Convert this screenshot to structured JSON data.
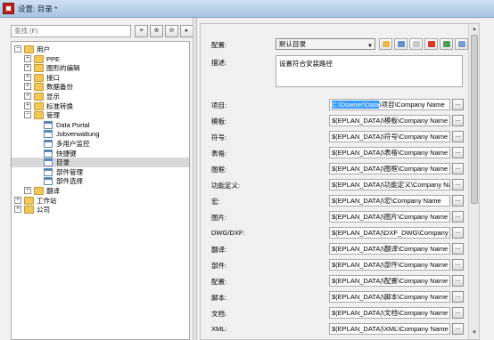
{
  "window": {
    "title": "设置: 目录 *"
  },
  "left": {
    "search_placeholder": "查找 (F)",
    "buttons": [
      "≡",
      "⊕",
      "⊖",
      "▸"
    ],
    "tree": [
      {
        "label": "用户",
        "level": 0,
        "type": "folder",
        "expander": "−"
      },
      {
        "label": "PPE",
        "level": 1,
        "type": "folder",
        "expander": "+"
      },
      {
        "label": "图形的编辑",
        "level": 1,
        "type": "folder",
        "expander": "+"
      },
      {
        "label": "接口",
        "level": 1,
        "type": "folder",
        "expander": "+"
      },
      {
        "label": "数据备份",
        "level": 1,
        "type": "folder",
        "expander": "+"
      },
      {
        "label": "显示",
        "level": 1,
        "type": "folder",
        "expander": "+"
      },
      {
        "label": "标准转换",
        "level": 1,
        "type": "folder",
        "expander": "+"
      },
      {
        "label": "管理",
        "level": 1,
        "type": "folder",
        "expander": "−"
      },
      {
        "label": "Data Portal",
        "level": 2,
        "type": "page",
        "expander": ""
      },
      {
        "label": "Jobverwaltung",
        "level": 2,
        "type": "page",
        "expander": ""
      },
      {
        "label": "多用户监控",
        "level": 2,
        "type": "page",
        "expander": ""
      },
      {
        "label": "快捷键",
        "level": 2,
        "type": "page",
        "expander": ""
      },
      {
        "label": "目录",
        "level": 2,
        "type": "page",
        "expander": "",
        "selected": true
      },
      {
        "label": "部件管理",
        "level": 2,
        "type": "page",
        "expander": ""
      },
      {
        "label": "部件选择",
        "level": 2,
        "type": "page",
        "expander": ""
      },
      {
        "label": "翻译",
        "level": 1,
        "type": "folder",
        "expander": "+"
      },
      {
        "label": "工作站",
        "level": 0,
        "type": "folder",
        "expander": "+"
      },
      {
        "label": "公司",
        "level": 0,
        "type": "folder",
        "expander": "+"
      }
    ]
  },
  "right": {
    "config_label": "配置:",
    "config_value": "默认目录",
    "desc_label": "描述:",
    "desc_value": "设置符合安装路径",
    "toolbar_colors": [
      "#e8b84a",
      "#6a8fc4",
      "#c8c8c8",
      "#d23a2c",
      "#4f9e58",
      "#7a9bc8"
    ],
    "browse_label": "...",
    "fields": [
      {
        "label": "项目:",
        "value": "C:\\Downer\\Data\\项目\\Company Name",
        "highlight": "C:\\Downer\\Data",
        "rest": "\\项目\\Company Name"
      },
      {
        "label": "模板:",
        "value": "$(EPLAN_DATA)\\模板\\Company Name"
      },
      {
        "label": "符号:",
        "value": "$(EPLAN_DATA)\\符号\\Company Name"
      },
      {
        "label": "表格:",
        "value": "$(EPLAN_DATA)\\表格\\Company Name"
      },
      {
        "label": "图框:",
        "value": "$(EPLAN_DATA)\\图框\\Company Name"
      },
      {
        "label": "功能定义:",
        "value": "$(EPLAN_DATA)\\功能定义\\Company Nam"
      },
      {
        "label": "宏:",
        "value": "$(EPLAN_DATA)\\宏\\Company Name"
      },
      {
        "label": "图片:",
        "value": "$(EPLAN_DATA)\\图片\\Company Name"
      },
      {
        "label": "DWG/DXF:",
        "value": "$(EPLAN_DATA)\\DXF_DWG\\Company Na"
      },
      {
        "label": "翻译:",
        "value": "$(EPLAN_DATA)\\翻译\\Company Name"
      },
      {
        "label": "部件:",
        "value": "$(EPLAN_DATA)\\部件\\Company Name"
      },
      {
        "label": "配置:",
        "value": "$(EPLAN_DATA)\\配置\\Company Name"
      },
      {
        "label": "脚本:",
        "value": "$(EPLAN_DATA)\\脚本\\Company Name"
      },
      {
        "label": "文档:",
        "value": "$(EPLAN_DATA)\\文档\\Company Name"
      },
      {
        "label": "XML:",
        "value": "$(EPLAN_DATA)\\XML\\Company Name"
      }
    ]
  }
}
